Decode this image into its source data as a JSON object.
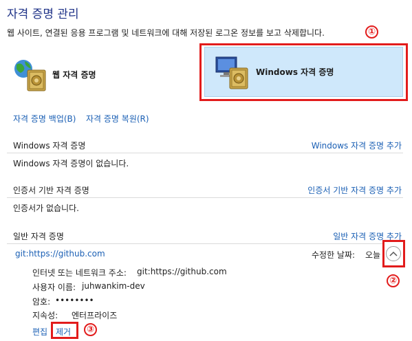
{
  "header": {
    "title": "자격 증명 관리",
    "description": "웹 사이트, 연결된 응용 프로그램 및 네트워크에 대해 저장된 로그온 정보를 보고 삭제합니다."
  },
  "tiles": {
    "web": {
      "label": "웹 자격 증명",
      "icon": "globe-vault-icon"
    },
    "windows": {
      "label": "Windows 자격 증명",
      "icon": "monitor-vault-icon",
      "selected": true
    }
  },
  "backup_restore": {
    "backup": "자격 증명 백업(B)",
    "restore": "자격 증명 복원(R)"
  },
  "sections": {
    "windows": {
      "title": "Windows 자격 증명",
      "add": "Windows 자격 증명 추가",
      "empty": "Windows 자격 증명이 없습니다."
    },
    "certificate": {
      "title": "인증서 기반 자격 증명",
      "add": "인증서 기반 자격 증명 추가",
      "empty": "인증서가 없습니다."
    },
    "generic": {
      "title": "일반 자격 증명",
      "add": "일반 자격 증명 추가"
    }
  },
  "credential": {
    "name": "git:https://github.com",
    "modified_label": "수정한 날짜:",
    "modified_value": "오늘",
    "address_label": "인터넷 또는 네트워크 주소:",
    "address_value": "git:https://github.com",
    "user_label": "사용자 이름:",
    "user_value": "juhwankim-dev",
    "password_label": "암호:",
    "password_value": "••••••••",
    "persist_label": "지속성:",
    "persist_value": "엔터프라이즈",
    "edit": "편집",
    "remove": "제거"
  },
  "annotations": {
    "one": "①",
    "two": "②",
    "three": "③",
    "color": "#e21b1b"
  },
  "colors": {
    "title": "#1e3287",
    "link": "#1a5fb4",
    "selected_tile": "#cfe8fb"
  }
}
